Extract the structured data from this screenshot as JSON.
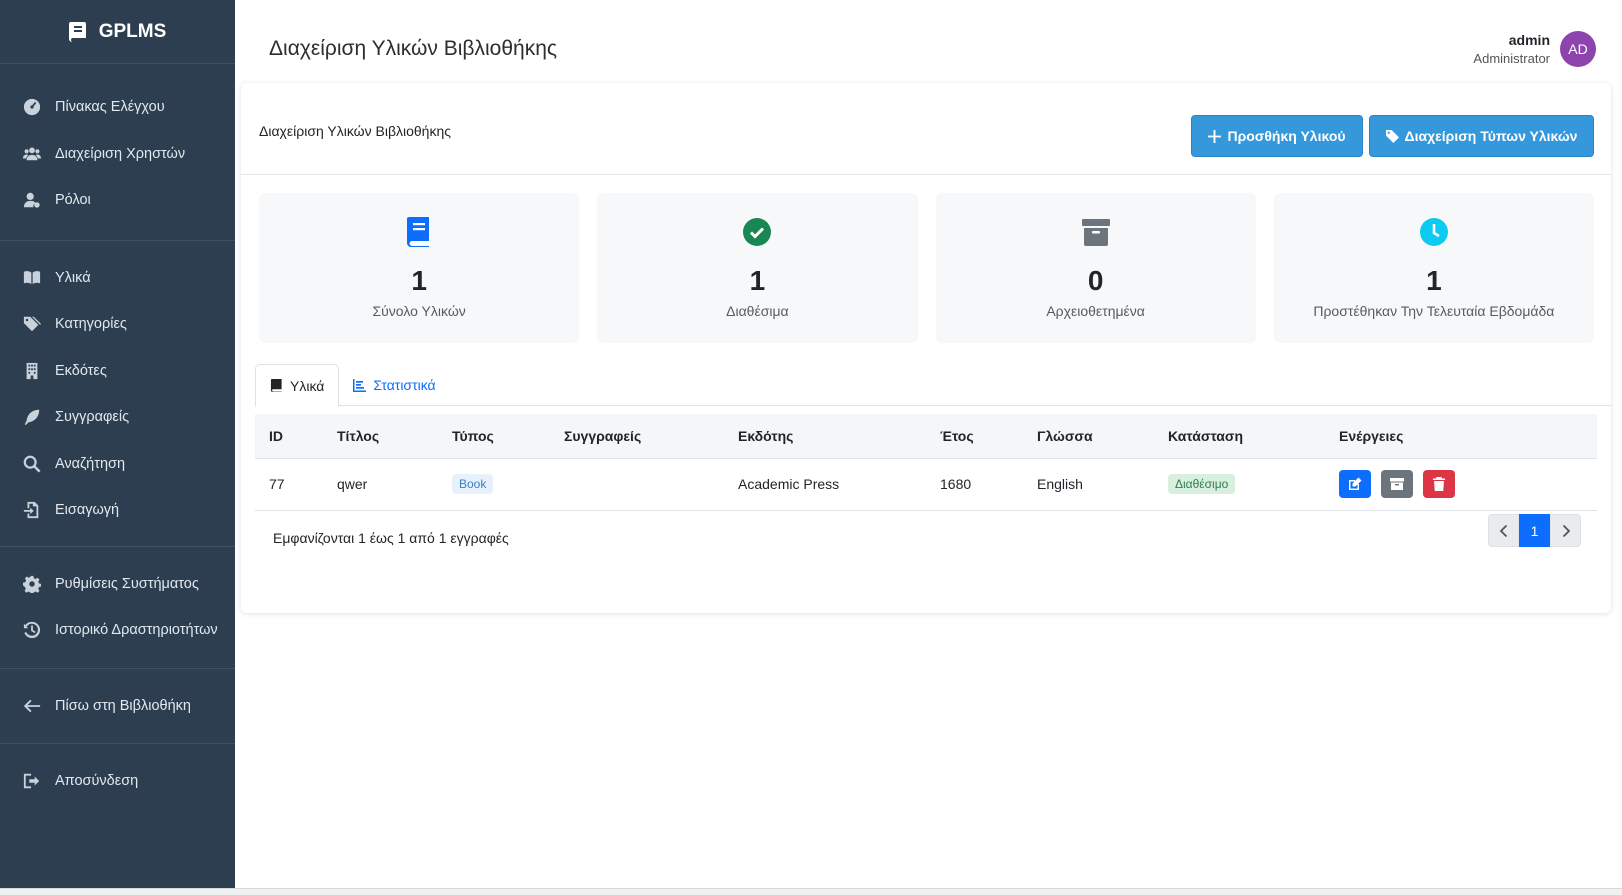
{
  "brand": {
    "name": "GPLMS"
  },
  "sidebar": {
    "groups": [
      [
        {
          "label": "Πίνακας Ελέγχου",
          "icon": "dashboard-icon"
        },
        {
          "label": "Διαχείριση Χρηστών",
          "icon": "users-icon"
        },
        {
          "label": "Ρόλοι",
          "icon": "user-role-icon"
        }
      ],
      [
        {
          "label": "Υλικά",
          "icon": "book-open-icon"
        },
        {
          "label": "Κατηγορίες",
          "icon": "tags-icon"
        },
        {
          "label": "Εκδότες",
          "icon": "building-icon"
        },
        {
          "label": "Συγγραφείς",
          "icon": "feather-icon"
        },
        {
          "label": "Αναζήτηση",
          "icon": "search-icon"
        },
        {
          "label": "Εισαγωγή",
          "icon": "import-icon"
        }
      ],
      [
        {
          "label": "Ρυθμίσεις Συστήματος",
          "icon": "gear-icon"
        },
        {
          "label": "Ιστορικό Δραστηριοτήτων",
          "icon": "history-icon"
        }
      ],
      [
        {
          "label": "Πίσω στη Βιβλιοθήκη",
          "icon": "arrow-left-icon"
        }
      ],
      [
        {
          "label": "Αποσύνδεση",
          "icon": "logout-icon"
        }
      ]
    ]
  },
  "header": {
    "title": "Διαχείριση Υλικών Βιβλιοθήκης",
    "user_name": "admin",
    "user_role": "Administrator",
    "avatar_initials": "AD"
  },
  "card": {
    "title": "Διαχείριση Υλικών Βιβλιοθήκης",
    "add_button": "Προσθήκη Υλικού",
    "types_button": "Διαχείριση Τύπων Υλικών"
  },
  "stats": [
    {
      "value": "1",
      "label": "Σύνολο Υλικών",
      "icon": "book-icon",
      "color": "#0d6efd"
    },
    {
      "value": "1",
      "label": "Διαθέσιμα",
      "icon": "check-circle-icon",
      "color": "#198754"
    },
    {
      "value": "0",
      "label": "Αρχειοθετημένα",
      "icon": "archive-icon",
      "color": "#6c757d"
    },
    {
      "value": "1",
      "label": "Προστέθηκαν Την Τελευταία Εβδομάδα",
      "icon": "clock-icon",
      "color": "#0dcaf0"
    }
  ],
  "tabs": {
    "materials": "Υλικά",
    "statistics": "Στατιστικά"
  },
  "table": {
    "headers": [
      "ID",
      "Τίτλος",
      "Τύπος",
      "Συγγραφείς",
      "Εκδότης",
      "Έτος",
      "Γλώσσα",
      "Κατάσταση",
      "Ενέργειες"
    ],
    "rows": [
      {
        "id": "77",
        "title": "qwer",
        "type": "Book",
        "authors": "",
        "publisher": "Academic Press",
        "year": "1680",
        "language": "English",
        "status": "Διαθέσιμο"
      }
    ]
  },
  "footer": {
    "info": "Εμφανίζονται 1 έως 1 από 1 εγγραφές",
    "current_page": "1"
  }
}
